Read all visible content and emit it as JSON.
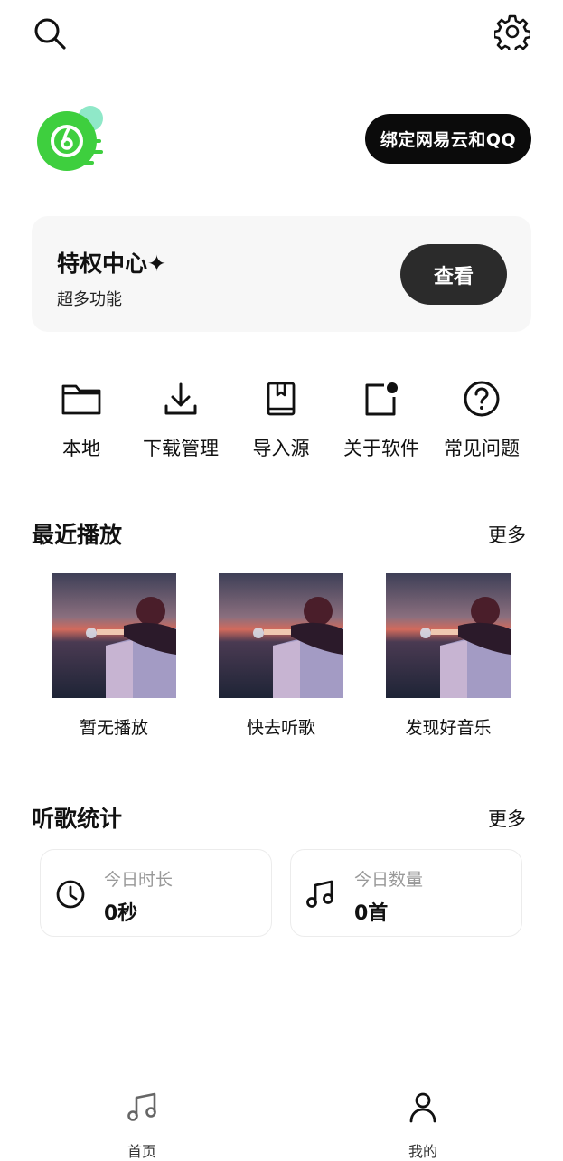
{
  "header": {
    "search_icon": "search-icon",
    "settings_icon": "gear-icon",
    "bind_button_label": "绑定网易云和QQ"
  },
  "privilege": {
    "title": "特权中心✦",
    "subtitle": "超多功能",
    "view_label": "查看"
  },
  "quick_actions": [
    {
      "label": "本地",
      "icon": "folder-icon"
    },
    {
      "label": "下载管理",
      "icon": "download-icon"
    },
    {
      "label": "导入源",
      "icon": "book-icon"
    },
    {
      "label": "关于软件",
      "icon": "notification-icon"
    },
    {
      "label": "常见问题",
      "icon": "question-icon"
    }
  ],
  "recent": {
    "title": "最近播放",
    "more": "更多",
    "items": [
      {
        "label": "暂无播放"
      },
      {
        "label": "快去听歌"
      },
      {
        "label": "发现好音乐"
      }
    ]
  },
  "stats": {
    "title": "听歌统计",
    "more": "更多",
    "duration": {
      "label": "今日时长",
      "value": "0秒"
    },
    "count": {
      "label": "今日数量",
      "value": "0首"
    }
  },
  "nav": {
    "home_label": "首页",
    "mine_label": "我的"
  },
  "colors": {
    "brand_green": "#3ecf3e",
    "dark_button": "#0b0b0b",
    "card_bg": "#f7f7f7"
  }
}
